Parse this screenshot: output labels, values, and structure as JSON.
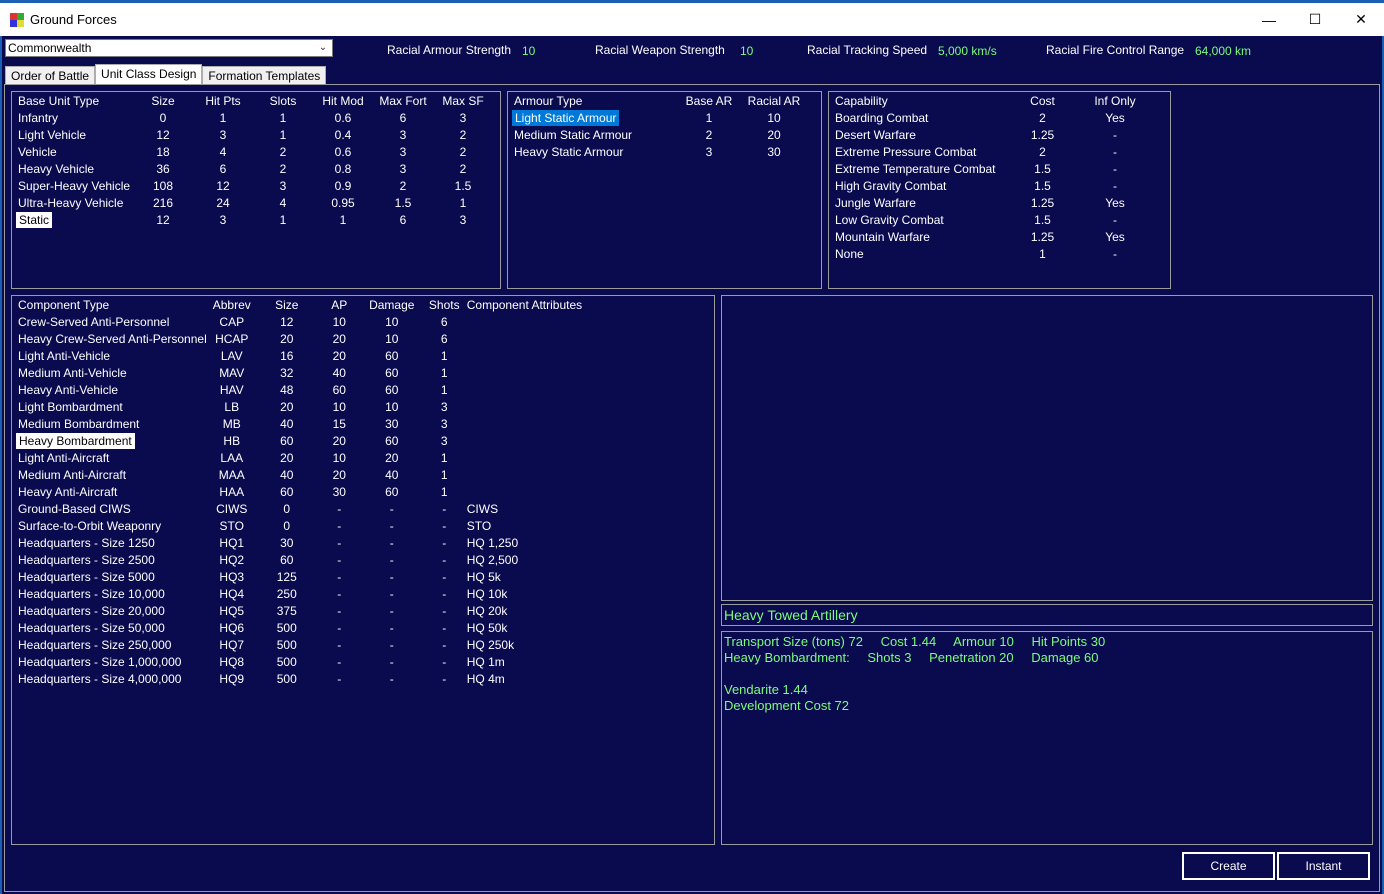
{
  "window": {
    "title": "Ground Forces",
    "minimize": "—",
    "maximize": "☐",
    "close": "✕"
  },
  "race_select": {
    "value": "Commonwealth"
  },
  "racial_stats": [
    {
      "label": "Racial Armour Strength",
      "value": "10"
    },
    {
      "label": "Racial  Weapon Strength",
      "value": "10"
    },
    {
      "label": "Racial  Tracking Speed",
      "value": "5,000 km/s"
    },
    {
      "label": "Racial Fire Control Range",
      "value": "64,000 km"
    }
  ],
  "tabs": [
    {
      "label": "Order of Battle",
      "active": false
    },
    {
      "label": "Unit Class Design",
      "active": true
    },
    {
      "label": "Formation Templates",
      "active": false
    }
  ],
  "base_unit_table": {
    "headers": [
      "Base Unit Type",
      "Size",
      "Hit Pts",
      "Slots",
      "Hit Mod",
      "Max Fort",
      "Max SF"
    ],
    "rows": [
      [
        "Infantry",
        "0",
        "1",
        "1",
        "0.6",
        "6",
        "3"
      ],
      [
        "Light Vehicle",
        "12",
        "3",
        "1",
        "0.4",
        "3",
        "2"
      ],
      [
        "Vehicle",
        "18",
        "4",
        "2",
        "0.6",
        "3",
        "2"
      ],
      [
        "Heavy Vehicle",
        "36",
        "6",
        "2",
        "0.8",
        "3",
        "2"
      ],
      [
        "Super-Heavy Vehicle",
        "108",
        "12",
        "3",
        "0.9",
        "2",
        "1.5"
      ],
      [
        "Ultra-Heavy Vehicle",
        "216",
        "24",
        "4",
        "0.95",
        "1.5",
        "1"
      ],
      [
        "Static",
        "12",
        "3",
        "1",
        "1",
        "6",
        "3"
      ]
    ],
    "selected_row": 6
  },
  "armour_table": {
    "headers": [
      "Armour Type",
      "Base AR",
      "Racial AR"
    ],
    "rows": [
      [
        "Light Static Armour",
        "1",
        "10"
      ],
      [
        "Medium Static Armour",
        "2",
        "20"
      ],
      [
        "Heavy Static Armour",
        "3",
        "30"
      ]
    ],
    "selected_row": 0
  },
  "capability_table": {
    "headers": [
      "Capability",
      "Cost",
      "Inf Only"
    ],
    "rows": [
      [
        "Boarding Combat",
        "2",
        "Yes"
      ],
      [
        "Desert Warfare",
        "1.25",
        "-"
      ],
      [
        "Extreme Pressure Combat",
        "2",
        "-"
      ],
      [
        "Extreme Temperature Combat",
        "1.5",
        "-"
      ],
      [
        "High Gravity Combat",
        "1.5",
        "-"
      ],
      [
        "Jungle Warfare",
        "1.25",
        "Yes"
      ],
      [
        "Low Gravity Combat",
        "1.5",
        "-"
      ],
      [
        "Mountain Warfare",
        "1.25",
        "Yes"
      ],
      [
        "None",
        "1",
        "-"
      ]
    ]
  },
  "component_table": {
    "headers": [
      "Component Type",
      "Abbrev",
      "Size",
      "AP",
      "Damage",
      "Shots",
      "Component Attributes"
    ],
    "rows": [
      [
        "Crew-Served Anti-Personnel",
        "CAP",
        "12",
        "10",
        "10",
        "6",
        ""
      ],
      [
        "Heavy Crew-Served Anti-Personnel",
        "HCAP",
        "20",
        "20",
        "10",
        "6",
        ""
      ],
      [
        "Light Anti-Vehicle",
        "LAV",
        "16",
        "20",
        "60",
        "1",
        ""
      ],
      [
        "Medium Anti-Vehicle",
        "MAV",
        "32",
        "40",
        "60",
        "1",
        ""
      ],
      [
        "Heavy Anti-Vehicle",
        "HAV",
        "48",
        "60",
        "60",
        "1",
        ""
      ],
      [
        "Light Bombardment",
        "LB",
        "20",
        "10",
        "10",
        "3",
        ""
      ],
      [
        "Medium Bombardment",
        "MB",
        "40",
        "15",
        "30",
        "3",
        ""
      ],
      [
        "Heavy Bombardment",
        "HB",
        "60",
        "20",
        "60",
        "3",
        ""
      ],
      [
        "Light Anti-Aircraft",
        "LAA",
        "20",
        "10",
        "20",
        "1",
        ""
      ],
      [
        "Medium Anti-Aircraft",
        "MAA",
        "40",
        "20",
        "40",
        "1",
        ""
      ],
      [
        "Heavy Anti-Aircraft",
        "HAA",
        "60",
        "30",
        "60",
        "1",
        ""
      ],
      [
        "Ground-Based CIWS",
        "CIWS",
        "0",
        "-",
        "-",
        "-",
        "CIWS"
      ],
      [
        "Surface-to-Orbit Weaponry",
        "STO",
        "0",
        "-",
        "-",
        "-",
        "STO"
      ],
      [
        "Headquarters - Size 1250",
        "HQ1",
        "30",
        "-",
        "-",
        "-",
        "HQ 1,250"
      ],
      [
        "Headquarters - Size 2500",
        "HQ2",
        "60",
        "-",
        "-",
        "-",
        "HQ 2,500"
      ],
      [
        "Headquarters - Size 5000",
        "HQ3",
        "125",
        "-",
        "-",
        "-",
        "HQ 5k"
      ],
      [
        "Headquarters - Size 10,000",
        "HQ4",
        "250",
        "-",
        "-",
        "-",
        "HQ 10k"
      ],
      [
        "Headquarters - Size 20,000",
        "HQ5",
        "375",
        "-",
        "-",
        "-",
        "HQ 20k"
      ],
      [
        "Headquarters - Size 50,000",
        "HQ6",
        "500",
        "-",
        "-",
        "-",
        "HQ 50k"
      ],
      [
        "Headquarters - Size 250,000",
        "HQ7",
        "500",
        "-",
        "-",
        "-",
        "HQ 250k"
      ],
      [
        "Headquarters - Size 1,000,000",
        "HQ8",
        "500",
        "-",
        "-",
        "-",
        "HQ 1m"
      ],
      [
        "Headquarters - Size 4,000,000",
        "HQ9",
        "500",
        "-",
        "-",
        "-",
        "HQ 4m"
      ]
    ],
    "selected_row": 7
  },
  "unit_name": "Heavy Towed Artillery",
  "summary": {
    "line1": [
      "Transport Size (tons)  72",
      "Cost  1.44",
      "Armour  10",
      "Hit Points  30"
    ],
    "line2": [
      "Heavy Bombardment:",
      "Shots 3",
      "Penetration 20",
      "Damage 60"
    ],
    "line3": "",
    "line4": "Vendarite  1.44",
    "line5": "Development Cost  72"
  },
  "buttons": {
    "create": "Create",
    "instant": "Instant"
  },
  "colors": {
    "background": "#0a0a4f",
    "accent_green": "#7cfc7c",
    "selection_blue": "#0078d7"
  }
}
